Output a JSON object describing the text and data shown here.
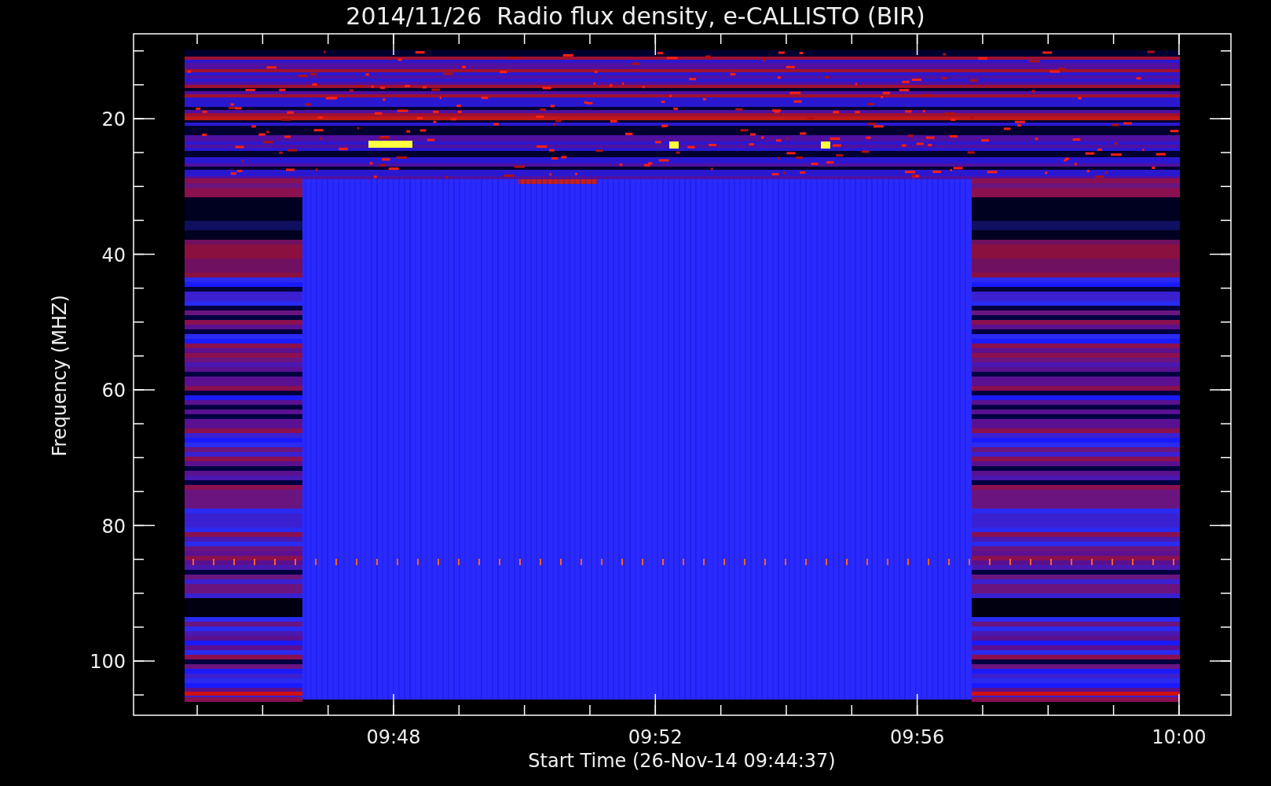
{
  "title": "2014/11/26  Radio flux density, e-CALLISTO (BIR)",
  "plot": {
    "ylabel": "Frequency (MHZ)",
    "xlabel": "Start Time (26-Nov-14 09:44:37)",
    "y_ticks": [
      "20",
      "40",
      "60",
      "80",
      "100"
    ],
    "x_ticks": [
      "09:48",
      "09:52",
      "09:56",
      "10:00"
    ]
  }
}
